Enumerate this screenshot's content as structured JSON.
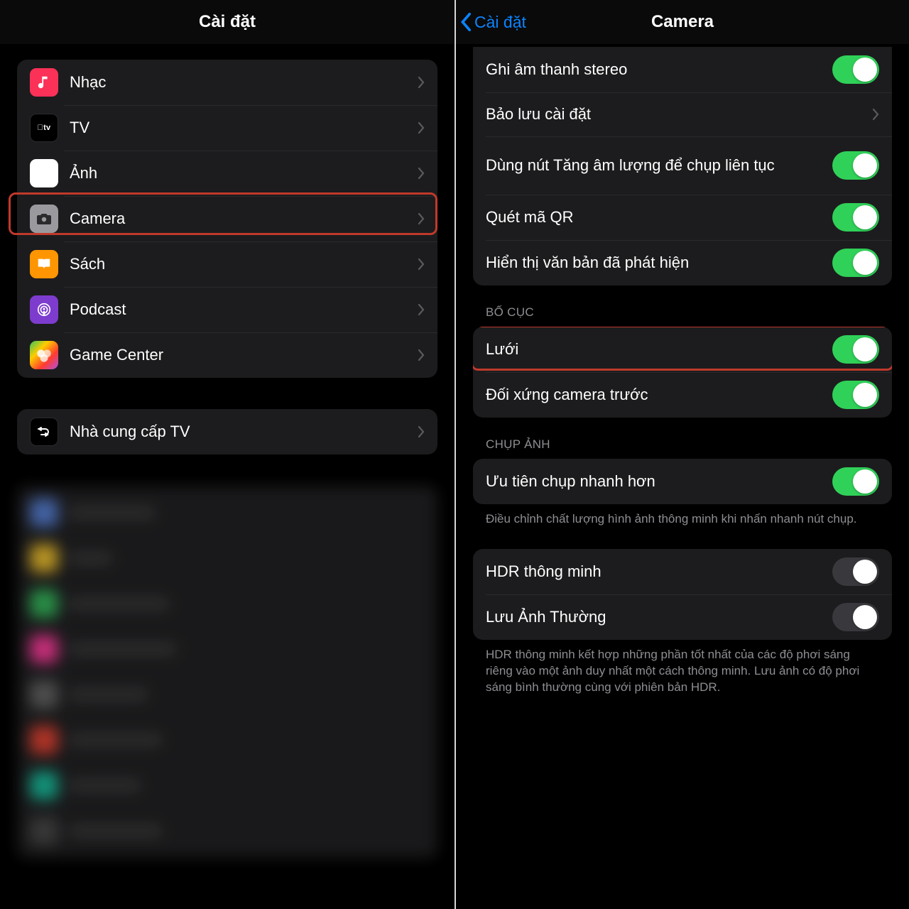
{
  "left": {
    "title": "Cài đặt",
    "groups": [
      {
        "rows": [
          {
            "icon": "music-icon",
            "label": "Nhạc"
          },
          {
            "icon": "tv-icon",
            "label": "TV"
          },
          {
            "icon": "photos-icon",
            "label": "Ảnh"
          },
          {
            "icon": "camera-icon",
            "label": "Camera",
            "highlighted": true
          },
          {
            "icon": "books-icon",
            "label": "Sách"
          },
          {
            "icon": "podcast-icon",
            "label": "Podcast"
          },
          {
            "icon": "gamecenter-icon",
            "label": "Game Center"
          }
        ]
      },
      {
        "rows": [
          {
            "icon": "tvprovider-icon",
            "label": "Nhà cung cấp TV"
          }
        ]
      }
    ]
  },
  "right": {
    "back_label": "Cài đặt",
    "title": "Camera",
    "groups": [
      {
        "rows": [
          {
            "label": "Ghi âm thanh stereo",
            "type": "toggle",
            "on": true
          },
          {
            "label": "Bảo lưu cài đặt",
            "type": "link"
          },
          {
            "label": "Dùng nút Tăng âm lượng để chụp liên tục",
            "type": "toggle",
            "on": true
          },
          {
            "label": "Quét mã QR",
            "type": "toggle",
            "on": true
          },
          {
            "label": "Hiển thị văn bản đã phát hiện",
            "type": "toggle",
            "on": true
          }
        ]
      },
      {
        "header": "BỐ CỤC",
        "rows": [
          {
            "label": "Lưới",
            "type": "toggle",
            "on": true,
            "highlighted": true
          },
          {
            "label": "Đối xứng camera trước",
            "type": "toggle",
            "on": true
          }
        ]
      },
      {
        "header": "CHỤP ẢNH",
        "rows": [
          {
            "label": "Ưu tiên chụp nhanh hơn",
            "type": "toggle",
            "on": true
          }
        ],
        "footer": "Điều chỉnh chất lượng hình ảnh thông minh khi nhấn nhanh nút chụp."
      },
      {
        "rows": [
          {
            "label": "HDR thông minh",
            "type": "toggle",
            "on": false
          },
          {
            "label": "Lưu Ảnh Thường",
            "type": "toggle",
            "on": false
          }
        ],
        "footer": "HDR thông minh kết hợp những phần tốt nhất của các độ phơi sáng riêng vào một ảnh duy nhất một cách thông minh. Lưu ảnh có độ phơi sáng bình thường cùng với phiên bản HDR."
      }
    ]
  }
}
